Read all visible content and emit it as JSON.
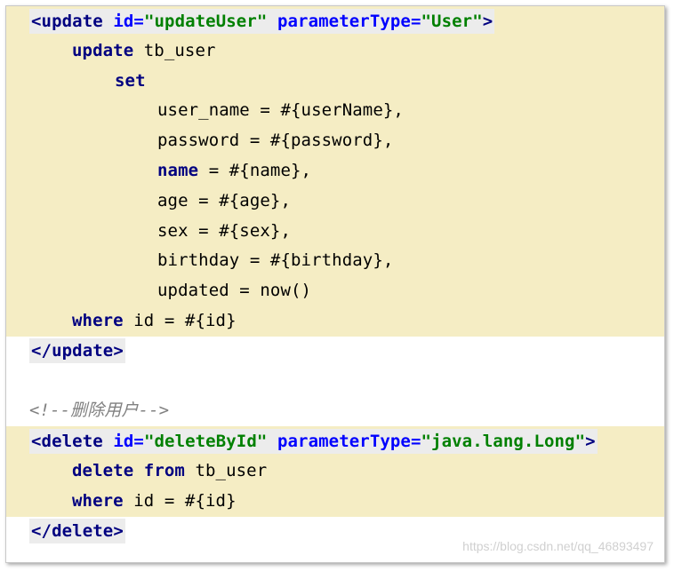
{
  "lines": {
    "l1": {
      "open": "<",
      "tag": "update",
      "a1": "id=",
      "v1": "\"updateUser\"",
      "a2": "parameterType=",
      "v2": "\"User\"",
      "close": ">"
    },
    "l2": {
      "kw": "update",
      "rest": " tb_user"
    },
    "l3": {
      "kw": "set"
    },
    "l4": {
      "text": "user_name = #{userName},"
    },
    "l5": {
      "text": "password = #{password},"
    },
    "l6": {
      "kw": "name",
      "rest": " = #{name},"
    },
    "l7": {
      "text": "age = #{age},"
    },
    "l8": {
      "text": "sex = #{sex},"
    },
    "l9": {
      "text": "birthday = #{birthday},"
    },
    "l10": {
      "text": "updated = now()"
    },
    "l11": {
      "kw": "where",
      "rest": " id = #{id}"
    },
    "l12": {
      "open": "</",
      "tag": "update",
      "close": ">"
    },
    "l13": {
      "text": ""
    },
    "l14": {
      "comment": "<!--删除用户-->"
    },
    "l15": {
      "open": "<",
      "tag": "delete",
      "a1": "id=",
      "v1": "\"deleteById\"",
      "a2": "parameterType=",
      "v2": "\"java.lang.Long\"",
      "close": ">"
    },
    "l16": {
      "kw1": "delete",
      "kw2": "from",
      "rest": " tb_user"
    },
    "l17": {
      "kw": "where",
      "rest": " id = #{id}"
    },
    "l18": {
      "open": "</",
      "tag": "delete",
      "close": ">"
    }
  },
  "watermark": "https://blog.csdn.net/qq_46893497"
}
